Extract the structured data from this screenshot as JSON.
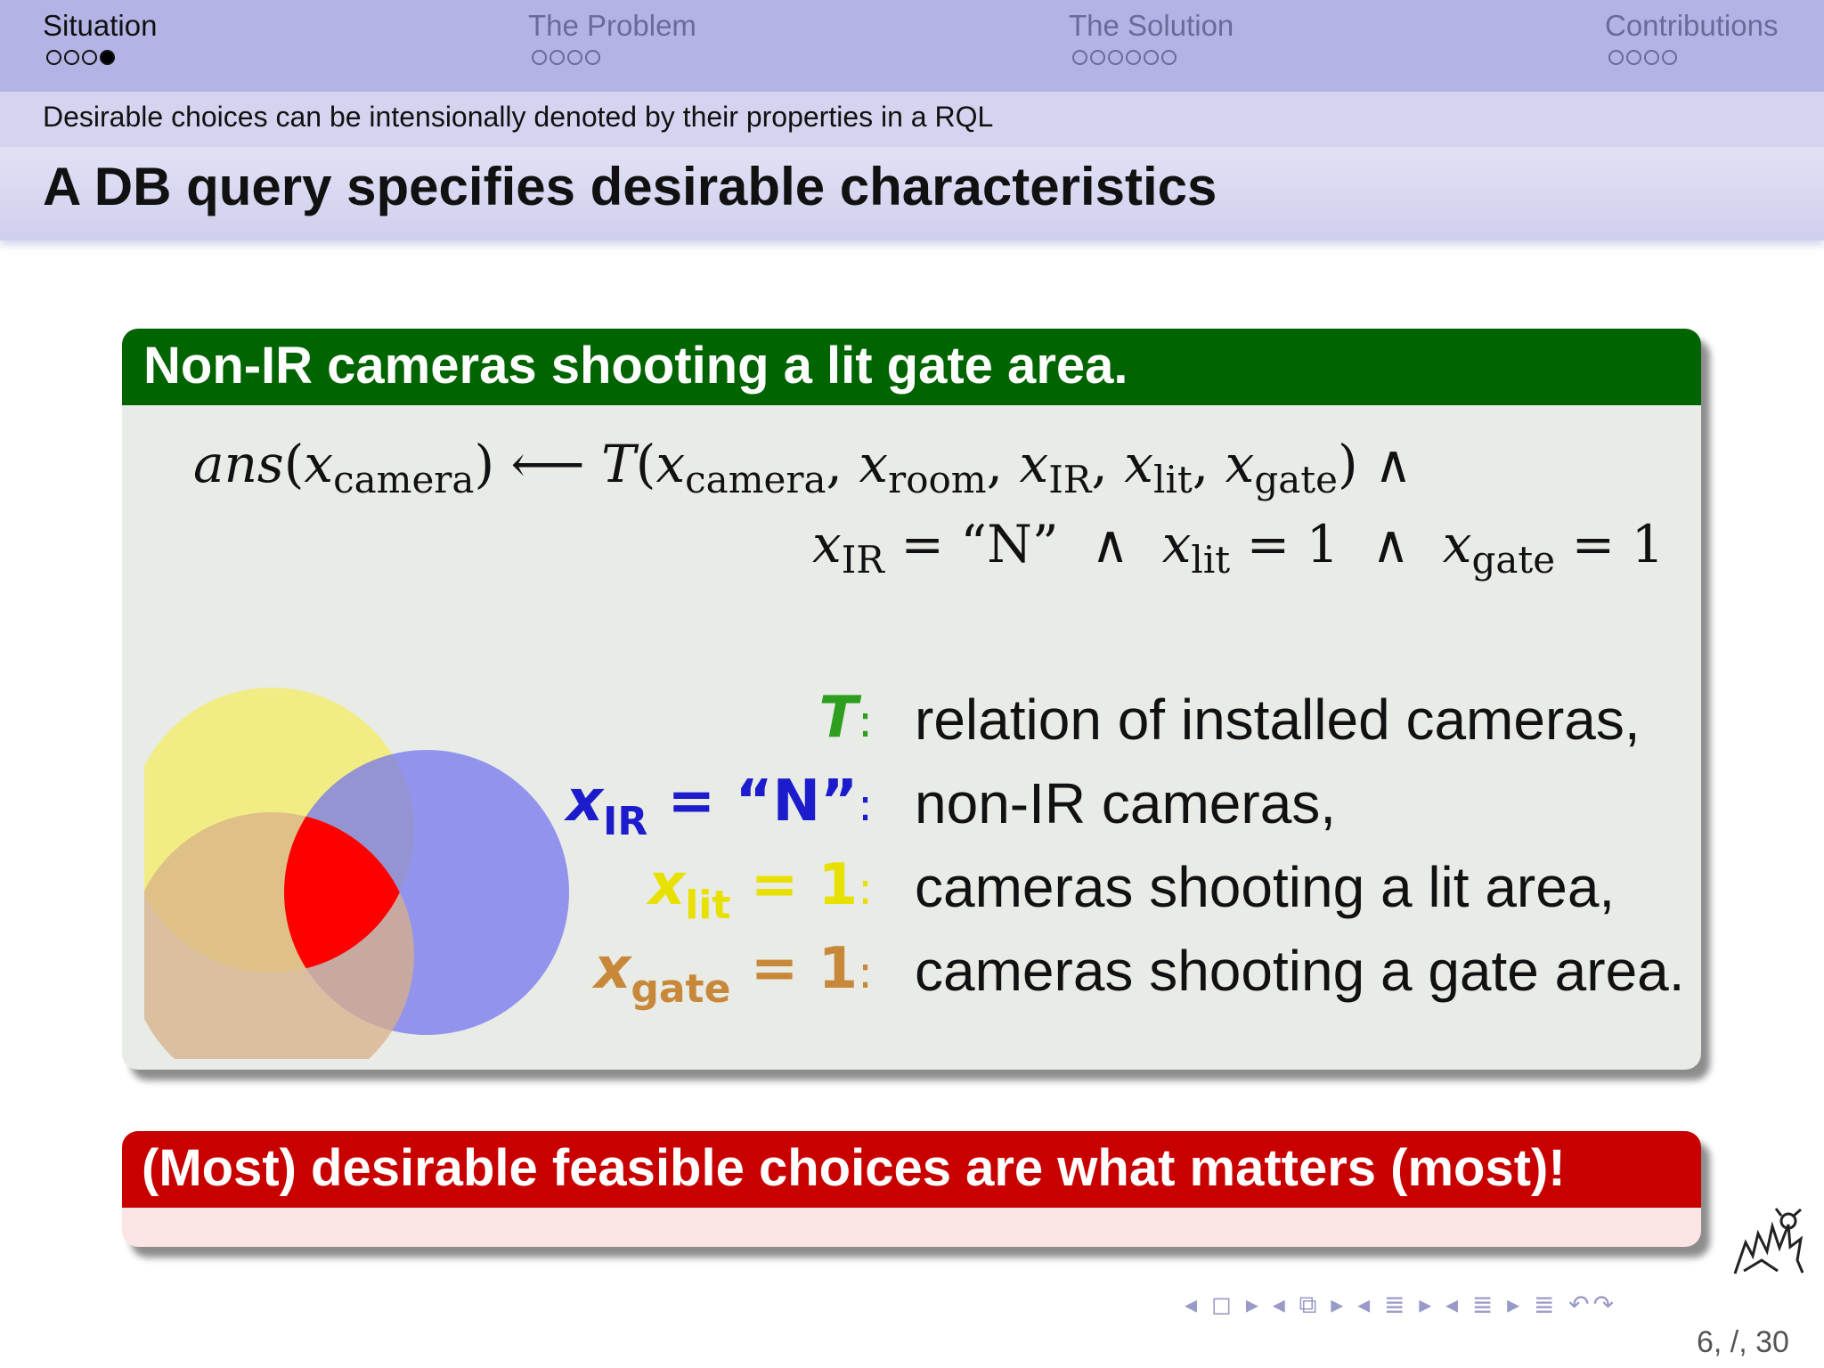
{
  "nav": {
    "sections": [
      {
        "label": "Situation",
        "dots": 4,
        "filled": 3
      },
      {
        "label": "The Problem",
        "dots": 4,
        "filled": -1
      },
      {
        "label": "The Solution",
        "dots": 6,
        "filled": -1
      },
      {
        "label": "Contributions",
        "dots": 4,
        "filled": -1
      }
    ]
  },
  "subtitle": "Desirable choices can be intensionally denoted by their properties in a RQL",
  "title": "A DB query specifies desirable characteristics",
  "example_block": {
    "heading": "Non-IR cameras shooting a lit gate area.",
    "formula": {
      "ans": "ans",
      "T": "T",
      "x": "x",
      "sub_camera": "camera",
      "sub_room": "room",
      "sub_IR": "IR",
      "sub_lit": "lit",
      "sub_gate": "gate",
      "arrow": "⟵",
      "and": "∧",
      "eq": "=",
      "N_str": "“N”",
      "one": "1",
      "period": "."
    },
    "legend": [
      {
        "symbol": "T",
        "sub": "",
        "rhs": "",
        "description": "relation of installed cameras,",
        "color": "#2e9e1f"
      },
      {
        "symbol": "x",
        "sub": "IR",
        "rhs": " = “N”",
        "description": "non-IR cameras,",
        "color": "#1c1ccc"
      },
      {
        "symbol": "x",
        "sub": "lit",
        "rhs": " = 1",
        "description": "cameras shooting a lit area,",
        "color": "#e8e000"
      },
      {
        "symbol": "x",
        "sub": "gate",
        "rhs": " = 1",
        "description": "cameras shooting a gate area.",
        "color": "#c8883a"
      }
    ],
    "colon": ":"
  },
  "venn_colors": {
    "yellow": "#f2ed72",
    "blue": "#7575ee",
    "tan": "#d8b088",
    "intersection": "#ff0000"
  },
  "alert_block": {
    "heading": "(Most) desirable feasible choices are what matters (most)!"
  },
  "footer": {
    "nav_symbols": "◂ ◻ ▸ ◂ ⧉ ▸ ◂ ≣ ▸ ◂ ≣ ▸ ≣ ↶↷",
    "page": "6, /, 30"
  }
}
